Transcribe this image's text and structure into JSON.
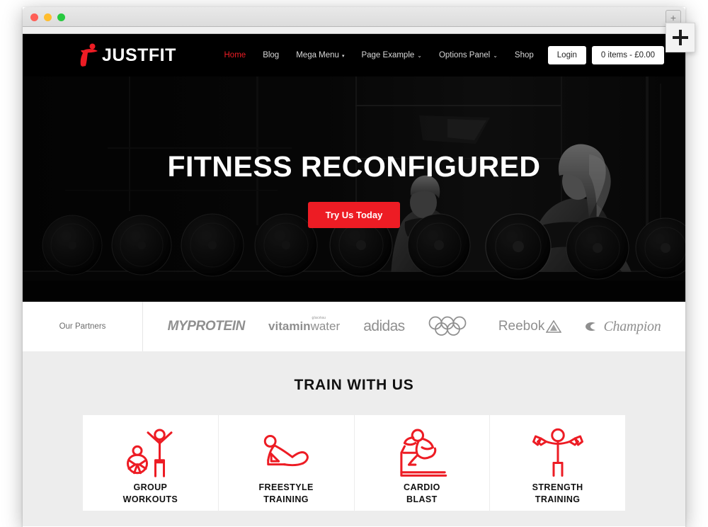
{
  "browser": {
    "traffic_lights": [
      "close",
      "minimize",
      "maximize"
    ],
    "new_tab_label": "+",
    "plus_overlay_label": "+"
  },
  "header": {
    "logo_text": "JUSTFIT",
    "nav": [
      {
        "label": "Home",
        "active": true,
        "caret": ""
      },
      {
        "label": "Blog",
        "active": false,
        "caret": ""
      },
      {
        "label": "Mega Menu",
        "active": false,
        "caret": "▾"
      },
      {
        "label": "Page Example",
        "active": false,
        "caret": "⌄"
      },
      {
        "label": "Options Panel",
        "active": false,
        "caret": "⌄"
      },
      {
        "label": "Shop",
        "active": false,
        "caret": ""
      }
    ],
    "login_label": "Login",
    "cart_label": "0 items - £0.00"
  },
  "hero": {
    "title": "FITNESS RECONFIGURED",
    "cta_label": "Try Us Today"
  },
  "partners": {
    "label": "Our Partners",
    "logos": [
      {
        "name": "myprotein",
        "text": "MYPROTEIN"
      },
      {
        "name": "vitaminwater",
        "text_bold": "vitamin",
        "text_thin": "water",
        "sup": "glacéau"
      },
      {
        "name": "adidas",
        "text": "adidas"
      },
      {
        "name": "olympics",
        "text": ""
      },
      {
        "name": "reebok",
        "text": "Reebok"
      },
      {
        "name": "champion",
        "text": "Champion"
      }
    ]
  },
  "train": {
    "title": "TRAIN WITH US",
    "cards": [
      {
        "icon": "group-workouts-icon",
        "line1": "GROUP",
        "line2": "WORKOUTS"
      },
      {
        "icon": "freestyle-training-icon",
        "line1": "FREESTYLE",
        "line2": "TRAINING"
      },
      {
        "icon": "cardio-blast-icon",
        "line1": "CARDIO",
        "line2": "BLAST"
      },
      {
        "icon": "strength-training-icon",
        "line1": "STRENGTH",
        "line2": "TRAINING"
      }
    ]
  },
  "colors": {
    "accent_red": "#ED1C24",
    "header_bg": "#000000",
    "section_bg": "#ededed",
    "card_bg": "#ffffff",
    "logo_gray": "#8f8f8f"
  }
}
